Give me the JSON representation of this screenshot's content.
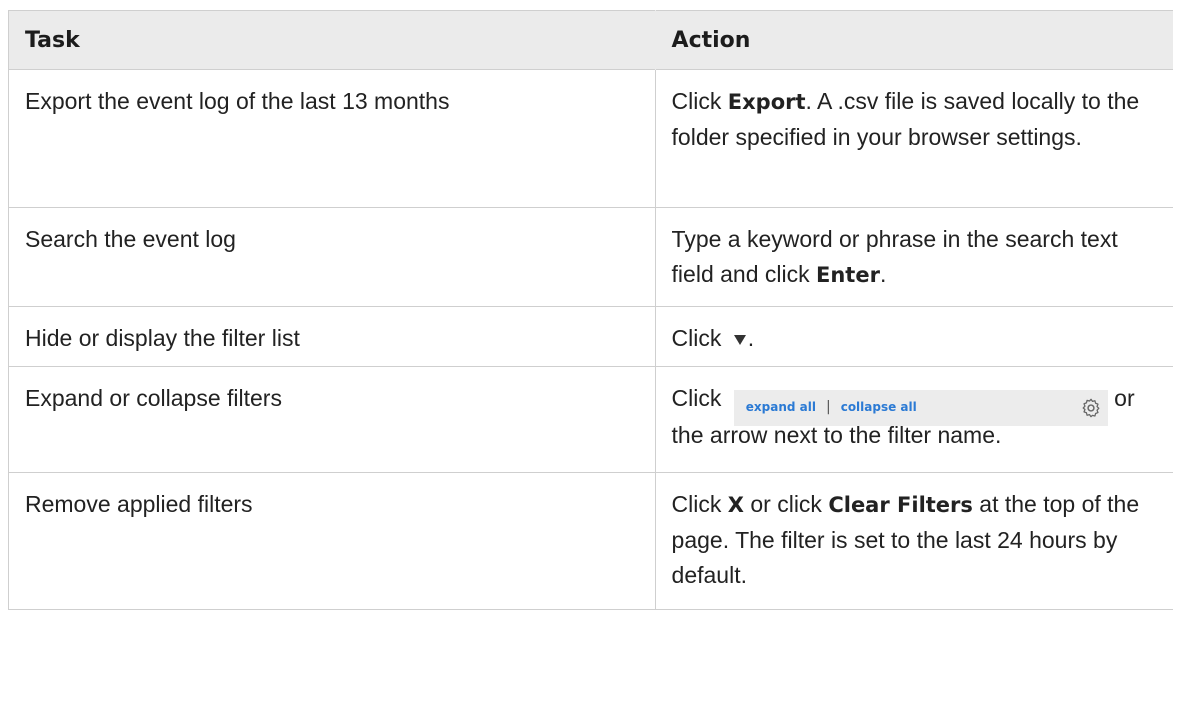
{
  "table": {
    "headers": {
      "task": "Task",
      "action": "Action"
    },
    "rows": [
      {
        "task": "Export the event log of the last 13 months",
        "action": {
          "pre": "Click ",
          "bold": "Export",
          "post": ". A .csv file is saved locally to the folder specified in your browser settings."
        }
      },
      {
        "task": "Search the event log",
        "action": {
          "pre": "Type a keyword or phrase in the search text field and click ",
          "bold": "Enter",
          "post": "."
        }
      },
      {
        "task": "Hide or display the filter list",
        "action": {
          "pre": "Click ",
          "icon": "filter-icon",
          "post": "."
        }
      },
      {
        "task": "Expand or collapse filters",
        "action": {
          "pre": "Click ",
          "widget": {
            "expand": "expand all",
            "separator": "|",
            "collapse": "collapse all",
            "icon": "gear-icon"
          },
          "post": " or the arrow next to the filter name."
        }
      },
      {
        "task": "Remove applied filters",
        "action": {
          "pre": "Click ",
          "bold1": "X",
          "mid": " or click ",
          "bold2": "Clear Filters",
          "post": " at the top of the page. The filter is set to the last 24 hours by default."
        }
      }
    ]
  },
  "colors": {
    "header_bg": "#ebebeb",
    "link": "#2b7ad4",
    "border": "#cfcfcf"
  }
}
